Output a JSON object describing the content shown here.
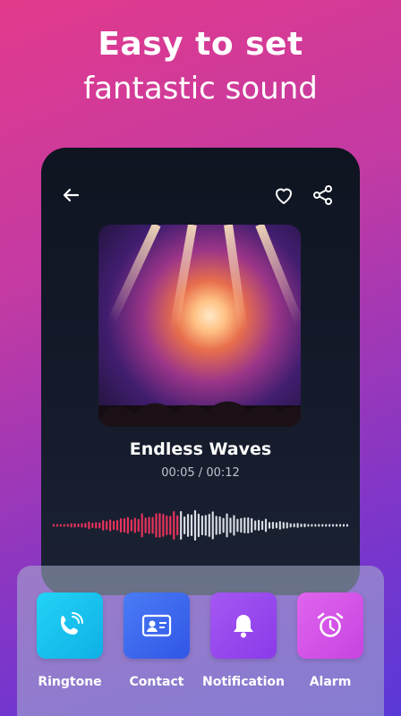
{
  "headline": {
    "line1": "Easy to set",
    "line2": "fantastic sound"
  },
  "player": {
    "title": "Endless Waves",
    "time_current": "00:05",
    "time_separator": " / ",
    "time_total": "00:12",
    "progress": 0.42
  },
  "icons": {
    "back": "back-arrow-icon",
    "favorite": "heart-icon",
    "share": "share-icon"
  },
  "actions": [
    {
      "label": "Ringtone",
      "icon": "phone-ringing-icon",
      "color": "#17c7f0"
    },
    {
      "label": "Contact",
      "icon": "contact-card-icon",
      "color": "#3f6cf2"
    },
    {
      "label": "Notification",
      "icon": "bell-icon",
      "color": "#9b49f0"
    },
    {
      "label": "Alarm",
      "icon": "alarm-clock-icon",
      "color": "#d455e8"
    }
  ],
  "colors": {
    "played_wave": "#e7335d",
    "unplayed_wave": "#d9dce3"
  }
}
